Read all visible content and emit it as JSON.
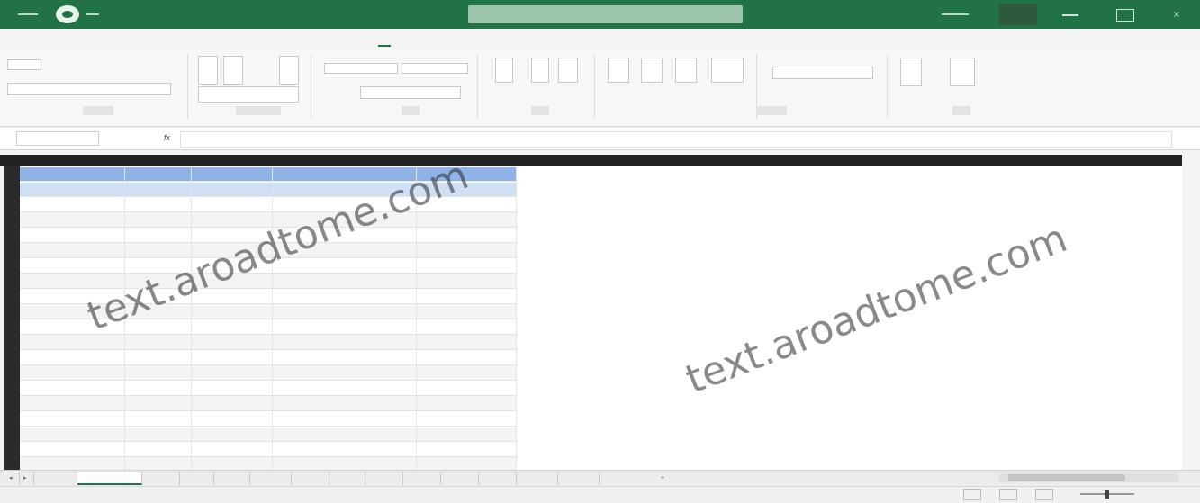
{
  "watermark": {
    "text": "text.aroadtome.com"
  },
  "colors": {
    "brand": "#217346",
    "selection": "#8fb3e6",
    "header_dark": "#232323"
  },
  "icons": [
    "excel-logo-icon",
    "minimize-icon",
    "maximize-icon",
    "close-icon",
    "fx-icon",
    "new-sheet-icon"
  ]
}
